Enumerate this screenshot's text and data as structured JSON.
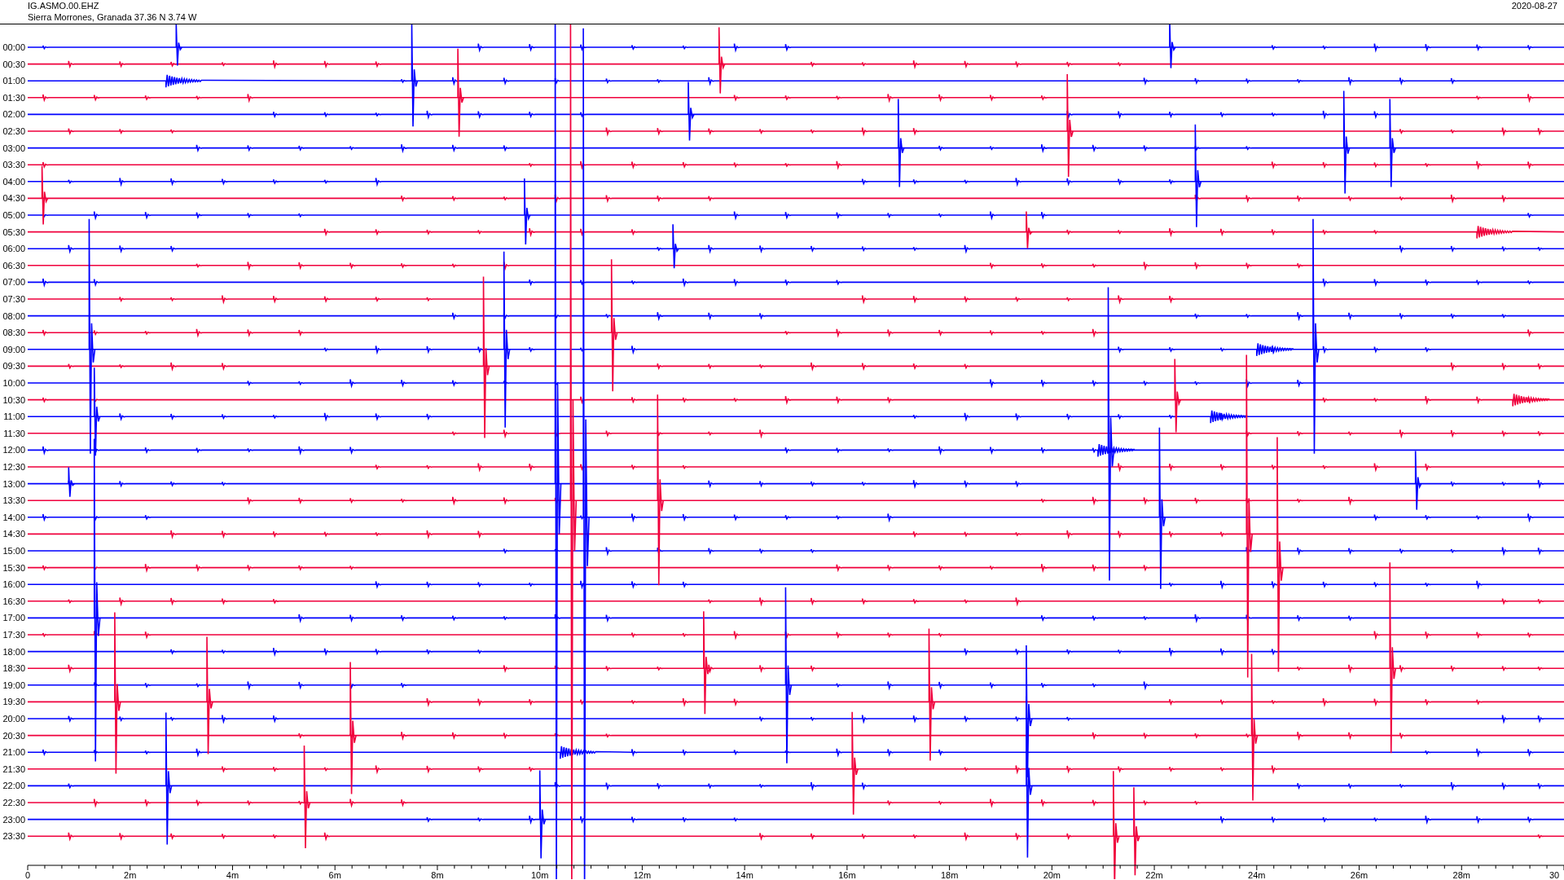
{
  "header": {
    "station": "IG.ASMO.00.EHZ",
    "location": "Sierra Morrones, Granada  37.36 N 3.74 W",
    "date": "2020-08-27"
  },
  "helicorder": {
    "rows": [
      {
        "label": "00:00",
        "color": "#0000ff"
      },
      {
        "label": "00:30",
        "color": "#f0003c"
      },
      {
        "label": "01:00",
        "color": "#0000ff"
      },
      {
        "label": "01:30",
        "color": "#f0003c"
      },
      {
        "label": "02:00",
        "color": "#0000ff"
      },
      {
        "label": "02:30",
        "color": "#f0003c"
      },
      {
        "label": "03:00",
        "color": "#0000ff"
      },
      {
        "label": "03:30",
        "color": "#f0003c"
      },
      {
        "label": "04:00",
        "color": "#0000ff"
      },
      {
        "label": "04:30",
        "color": "#f0003c"
      },
      {
        "label": "05:00",
        "color": "#0000ff"
      },
      {
        "label": "05:30",
        "color": "#f0003c"
      },
      {
        "label": "06:00",
        "color": "#0000ff"
      },
      {
        "label": "06:30",
        "color": "#f0003c"
      },
      {
        "label": "07:00",
        "color": "#0000ff"
      },
      {
        "label": "07:30",
        "color": "#f0003c"
      },
      {
        "label": "08:00",
        "color": "#0000ff"
      },
      {
        "label": "08:30",
        "color": "#f0003c"
      },
      {
        "label": "09:00",
        "color": "#0000ff"
      },
      {
        "label": "09:30",
        "color": "#f0003c"
      },
      {
        "label": "10:00",
        "color": "#0000ff"
      },
      {
        "label": "10:30",
        "color": "#f0003c"
      },
      {
        "label": "11:00",
        "color": "#0000ff"
      },
      {
        "label": "11:30",
        "color": "#f0003c"
      },
      {
        "label": "12:00",
        "color": "#0000ff"
      },
      {
        "label": "12:30",
        "color": "#f0003c"
      },
      {
        "label": "13:00",
        "color": "#0000ff"
      },
      {
        "label": "13:30",
        "color": "#f0003c"
      },
      {
        "label": "14:00",
        "color": "#0000ff"
      },
      {
        "label": "14:30",
        "color": "#f0003c"
      },
      {
        "label": "15:00",
        "color": "#0000ff"
      },
      {
        "label": "15:30",
        "color": "#f0003c"
      },
      {
        "label": "16:00",
        "color": "#0000ff"
      },
      {
        "label": "16:30",
        "color": "#f0003c"
      },
      {
        "label": "17:00",
        "color": "#0000ff"
      },
      {
        "label": "17:30",
        "color": "#f0003c"
      },
      {
        "label": "18:00",
        "color": "#0000ff"
      },
      {
        "label": "18:30",
        "color": "#f0003c"
      },
      {
        "label": "19:00",
        "color": "#0000ff"
      },
      {
        "label": "19:30",
        "color": "#f0003c"
      },
      {
        "label": "20:00",
        "color": "#0000ff"
      },
      {
        "label": "20:30",
        "color": "#f0003c"
      },
      {
        "label": "21:00",
        "color": "#0000ff"
      },
      {
        "label": "21:30",
        "color": "#f0003c"
      },
      {
        "label": "22:00",
        "color": "#0000ff"
      },
      {
        "label": "22:30",
        "color": "#f0003c"
      },
      {
        "label": "23:00",
        "color": "#0000ff"
      },
      {
        "label": "23:30",
        "color": "#f0003c"
      }
    ],
    "x_ticks": [
      "0",
      "2m",
      "4m",
      "6m",
      "8m",
      "10m",
      "12m",
      "14m",
      "16m",
      "18m",
      "20m",
      "22m",
      "24m",
      "26m",
      "28m",
      "30"
    ]
  }
}
